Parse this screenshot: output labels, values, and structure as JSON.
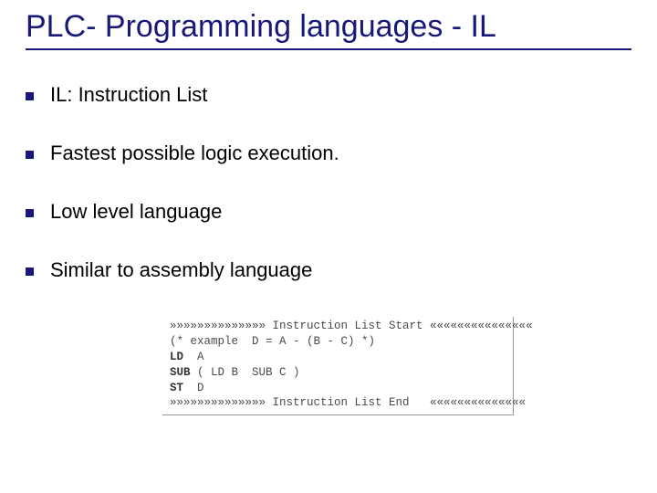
{
  "slide": {
    "title": "PLC- Programming languages - IL",
    "bullets": [
      "IL: Instruction List",
      "Fastest possible logic execution.",
      " Low level language",
      "Similar to assembly language"
    ],
    "code": {
      "l1": "»»»»»»»»»»»»»» Instruction List Start «««««««««««««««",
      "l2a": "(* example  D = A - (B - C) *)",
      "l2kw": "LD",
      "l2b": "  A",
      "l3kw": "SUB",
      "l3b": " ( LD B  SUB C )",
      "l4kw": "ST",
      "l4b": "  D",
      "l5": "»»»»»»»»»»»»»» Instruction List End   ««««««««««««««"
    }
  }
}
